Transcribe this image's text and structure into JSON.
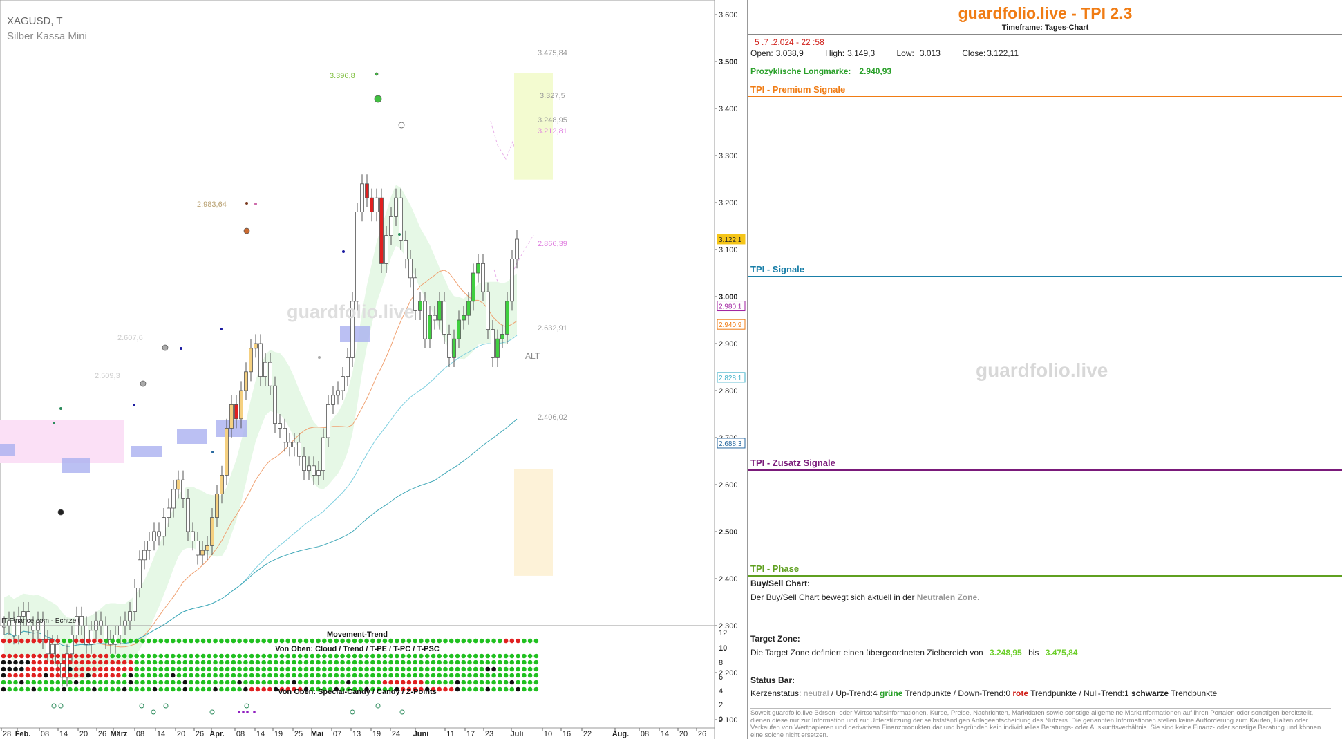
{
  "chart": {
    "symbol": "XAGUSD, T",
    "name": "Silber Kassa Mini",
    "source": "IT-Finance.com - Echtzeit",
    "watermark": "guardfolio.live",
    "target_upper": "3.475,84",
    "target_mid": "3.327,5",
    "target_lower": "3.248,95",
    "level_3212": "3.212,81",
    "level_2866": "2.866,39",
    "level_2632": "2.632,91",
    "level_2406": "2.406,02",
    "alt_label": "ALT",
    "note_3396": "3.396,8",
    "note_2983": "2.983,64",
    "note_2607": "2.607,6",
    "note_2509": "2.509,3",
    "movement_trend_label": "Movement-Trend",
    "von_oben_1": "Von Oben: Cloud / Trend / T-PE / T-PC / T-PSC",
    "von_oben_2": "Von Oben: Special-Candy / Candy / Z-Points"
  },
  "chart_data": {
    "type": "candlestick",
    "y_axis_ticks": [
      "3.600",
      "3.500",
      "3.400",
      "3.300",
      "3.200",
      "3.100",
      "3.000",
      "2.900",
      "2.800",
      "2.700",
      "2.600",
      "2.500",
      "2.400",
      "2.300",
      "2.200",
      "2.100",
      "2.000"
    ],
    "ylim": [
      1.97,
      3.63
    ],
    "x_axis_labels": [
      "28",
      "Feb.",
      "08",
      "14",
      "20",
      "26",
      "März",
      "08",
      "14",
      "20",
      "26",
      "Apr.",
      "08",
      "14",
      "19",
      "25",
      "Mai",
      "07",
      "13",
      "19",
      "24",
      "Juni",
      "11",
      "17",
      "23",
      "Juli",
      "10",
      "16",
      "22",
      "Aug.",
      "08",
      "14",
      "20",
      "26"
    ],
    "last_price": "3.122,1",
    "price_markers": [
      {
        "label": "3.122,1",
        "color": "#f5c518",
        "value": 3.1221
      },
      {
        "label": "2.980,1",
        "color": "#a020a0",
        "value": 2.9801
      },
      {
        "label": "2.940,9",
        "color": "#f07c14",
        "value": 2.9409
      },
      {
        "label": "2.828,1",
        "color": "#40b0c8",
        "value": 2.8281
      },
      {
        "label": "2.688,3",
        "color": "#2a6aa0",
        "value": 2.6883
      }
    ],
    "sub_axis_ticks": [
      "12",
      "10",
      "8",
      "6",
      "4",
      "2",
      "0"
    ],
    "closes": [
      2.3,
      2.31,
      2.28,
      2.32,
      2.33,
      2.3,
      2.29,
      2.31,
      2.27,
      2.24,
      2.26,
      2.22,
      2.19,
      2.24,
      2.28,
      2.32,
      2.3,
      2.26,
      2.29,
      2.31,
      2.3,
      2.27,
      2.26,
      2.28,
      2.3,
      2.31,
      2.33,
      2.38,
      2.44,
      2.46,
      2.48,
      2.5,
      2.49,
      2.53,
      2.55,
      2.59,
      2.61,
      2.57,
      2.5,
      2.48,
      2.45,
      2.46,
      2.47,
      2.53,
      2.58,
      2.62,
      2.72,
      2.77,
      2.74,
      2.8,
      2.84,
      2.89,
      2.9,
      2.83,
      2.86,
      2.81,
      2.73,
      2.72,
      2.69,
      2.68,
      2.69,
      2.66,
      2.63,
      2.64,
      2.62,
      2.63,
      2.7,
      2.77,
      2.79,
      2.8,
      2.83,
      2.87,
      2.99,
      3.18,
      3.24,
      3.21,
      3.18,
      3.21,
      3.07,
      3.13,
      3.17,
      3.21,
      3.12,
      3.08,
      3.04,
      2.97,
      2.99,
      2.91,
      2.96,
      2.95,
      2.99,
      2.92,
      2.87,
      2.91,
      2.95,
      2.96,
      2.99,
      3.05,
      3.07,
      3.01,
      2.93,
      2.87,
      2.91,
      2.92,
      2.99,
      3.08,
      3.122
    ]
  },
  "panel": {
    "brand": "guardfolio.live - TPI 2.3",
    "timeframe": "Timeframe: Tages-Chart",
    "timestamp": "5 .7 .2.024  - 22 :58",
    "open_label": "Open:",
    "open_value": "3.038,9",
    "high_label": "High:",
    "high_value": "3.149,3",
    "low_label": "Low:",
    "low_value": "3.013",
    "close_label": "Close:",
    "close_value": "3.122,11",
    "longmarke_label": "Prozyklische Longmarke:",
    "longmarke_value": "2.940,93",
    "premium_title": "TPI - Premium Signale",
    "signale_title": "TPI - Signale",
    "zusatz_title": "TPI - Zusatz Signale",
    "phase_title": "TPI - Phase",
    "watermark": "guardfolio.live",
    "buysell_title": "Buy/Sell Chart:",
    "buysell_text": "Der Buy/Sell Chart bewegt sich aktuell in der",
    "buysell_zone": "Neutralen Zone.",
    "target_title": "Target Zone:",
    "target_text": "Die Target Zone definiert einen übergeordneten Zielbereich von",
    "target_from": "3.248,95",
    "target_bis": "bis",
    "target_to": "3.475,84",
    "status_title": "Status Bar:",
    "status_1": "Kerzenstatus:",
    "status_neutral": "neutral",
    "status_2": "/ Up-Trend:4",
    "status_gruene": "grüne",
    "status_3": "Trendpunkte  / Down-Trend:0",
    "status_rote": "rote",
    "status_4": "Trendpunkte / Null-Trend:1",
    "status_schwarze": "schwarze",
    "status_5": "Trendpunkte",
    "disclaimer": "Soweit guardfolio.live Börsen- oder Wirtschaftsinformationen, Kurse, Preise, Nachrichten, Marktdaten sowie sonstige allgemeine Marktinformationen auf ihren Portalen oder sonstigen bereitstellt, dienen diese nur zur Information und zur Unterstützung der selbstständigen Anlageentscheidung des Nutzers. Die genannten Informationen stellen keine Aufforderung zum Kaufen, Halten oder Verkaufen von Wertpapieren und derivativen Finanzprodukten dar und begründen kein individuelles Beratungs- oder Auskunftsverhältnis. Sie sind keine Finanz- oder sonstige Beratung und können eine solche nicht ersetzen."
  }
}
